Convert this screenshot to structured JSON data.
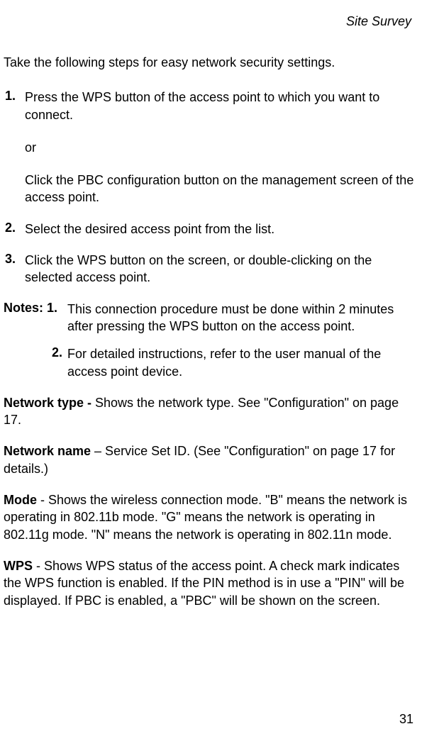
{
  "header": {
    "title": "Site Survey"
  },
  "intro": "Take the following steps for easy network security settings.",
  "steps": [
    {
      "number": "1.",
      "main": "Press the WPS button of the access point to which you want to connect.",
      "or": "or",
      "alt": "Click the PBC configuration button on the management screen of the access point."
    },
    {
      "number": "2.",
      "main": "Select the desired access point from the list."
    },
    {
      "number": "3.",
      "main": "Click the WPS button on the screen, or double-clicking on the selected access point."
    }
  ],
  "notes": {
    "label": "Notes: 1.",
    "item1": "This connection procedure must be done within 2 minutes after pressing the WPS button on the access point.",
    "num2": "2.",
    "item2": "For detailed instructions, refer to the user manual of the access point device."
  },
  "definitions": [
    {
      "label": "Network type - ",
      "text": "Shows the network type. See  \"Configuration\" on page 17."
    },
    {
      "label": "Network name",
      "text": " – Service Set ID. (See  \"Configuration\" on page 17 for details.)"
    },
    {
      "label": "Mode",
      "text": " - Shows the wireless connection mode. \"B\" means the network is operating in 802.11b mode. \"G\" means the network is operating in 802.11g mode. \"N\" means the network is operating in 802.11n mode."
    },
    {
      "label": "WPS",
      "text": " - Shows WPS status of the access point. A check mark indicates the WPS function is enabled. If the PIN method is in use a \"PIN\" will be displayed. If PBC is enabled, a \"PBC\" will be shown on the screen."
    }
  ],
  "pageNumber": "31"
}
